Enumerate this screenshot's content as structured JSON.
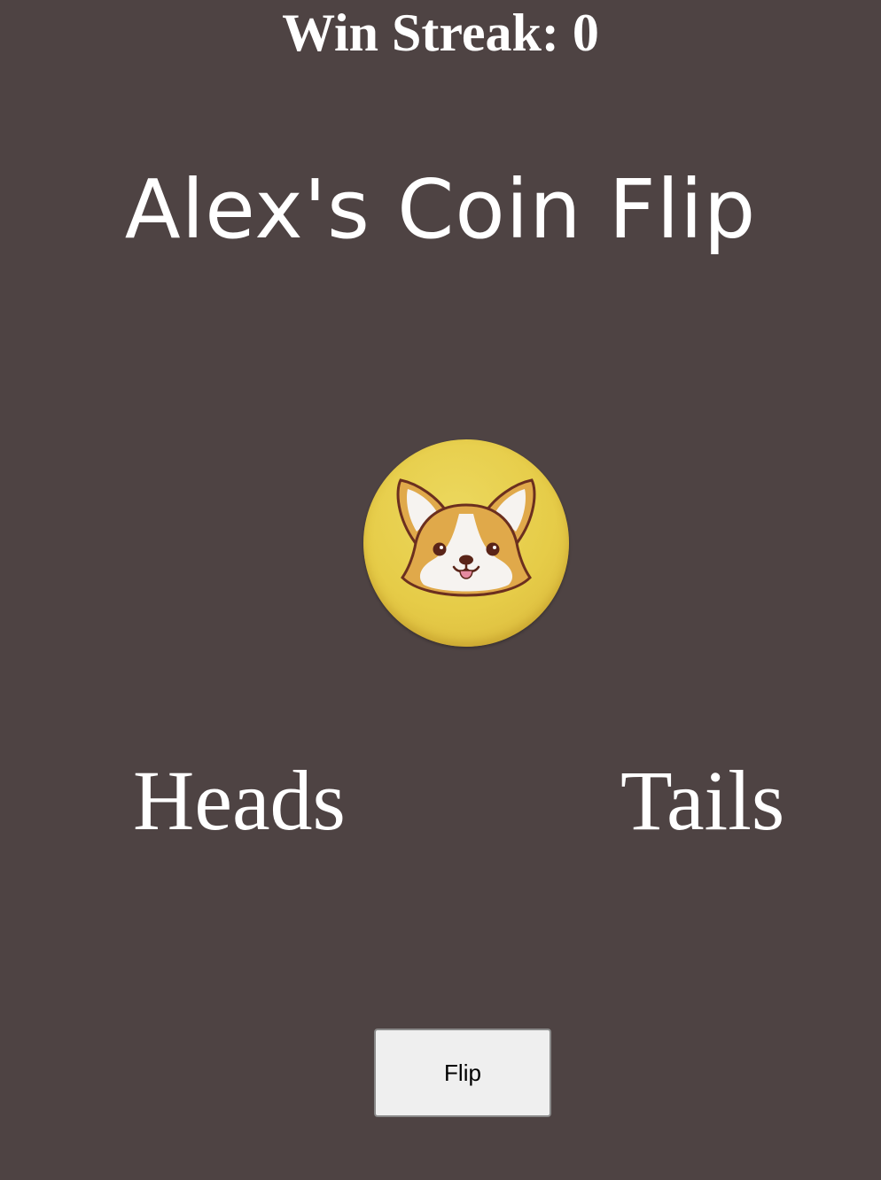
{
  "header": {
    "streak_text": "Win Streak: 0"
  },
  "title": "Alex's Coin Flip",
  "coin": {
    "face_icon": "corgi-face-icon",
    "color": "#e6cc48"
  },
  "choices": {
    "heads_label": "Heads",
    "tails_label": "Tails"
  },
  "controls": {
    "flip_label": "Flip"
  },
  "colors": {
    "background": "#4e4343",
    "text": "#ffffff",
    "button_bg": "#efefef"
  }
}
